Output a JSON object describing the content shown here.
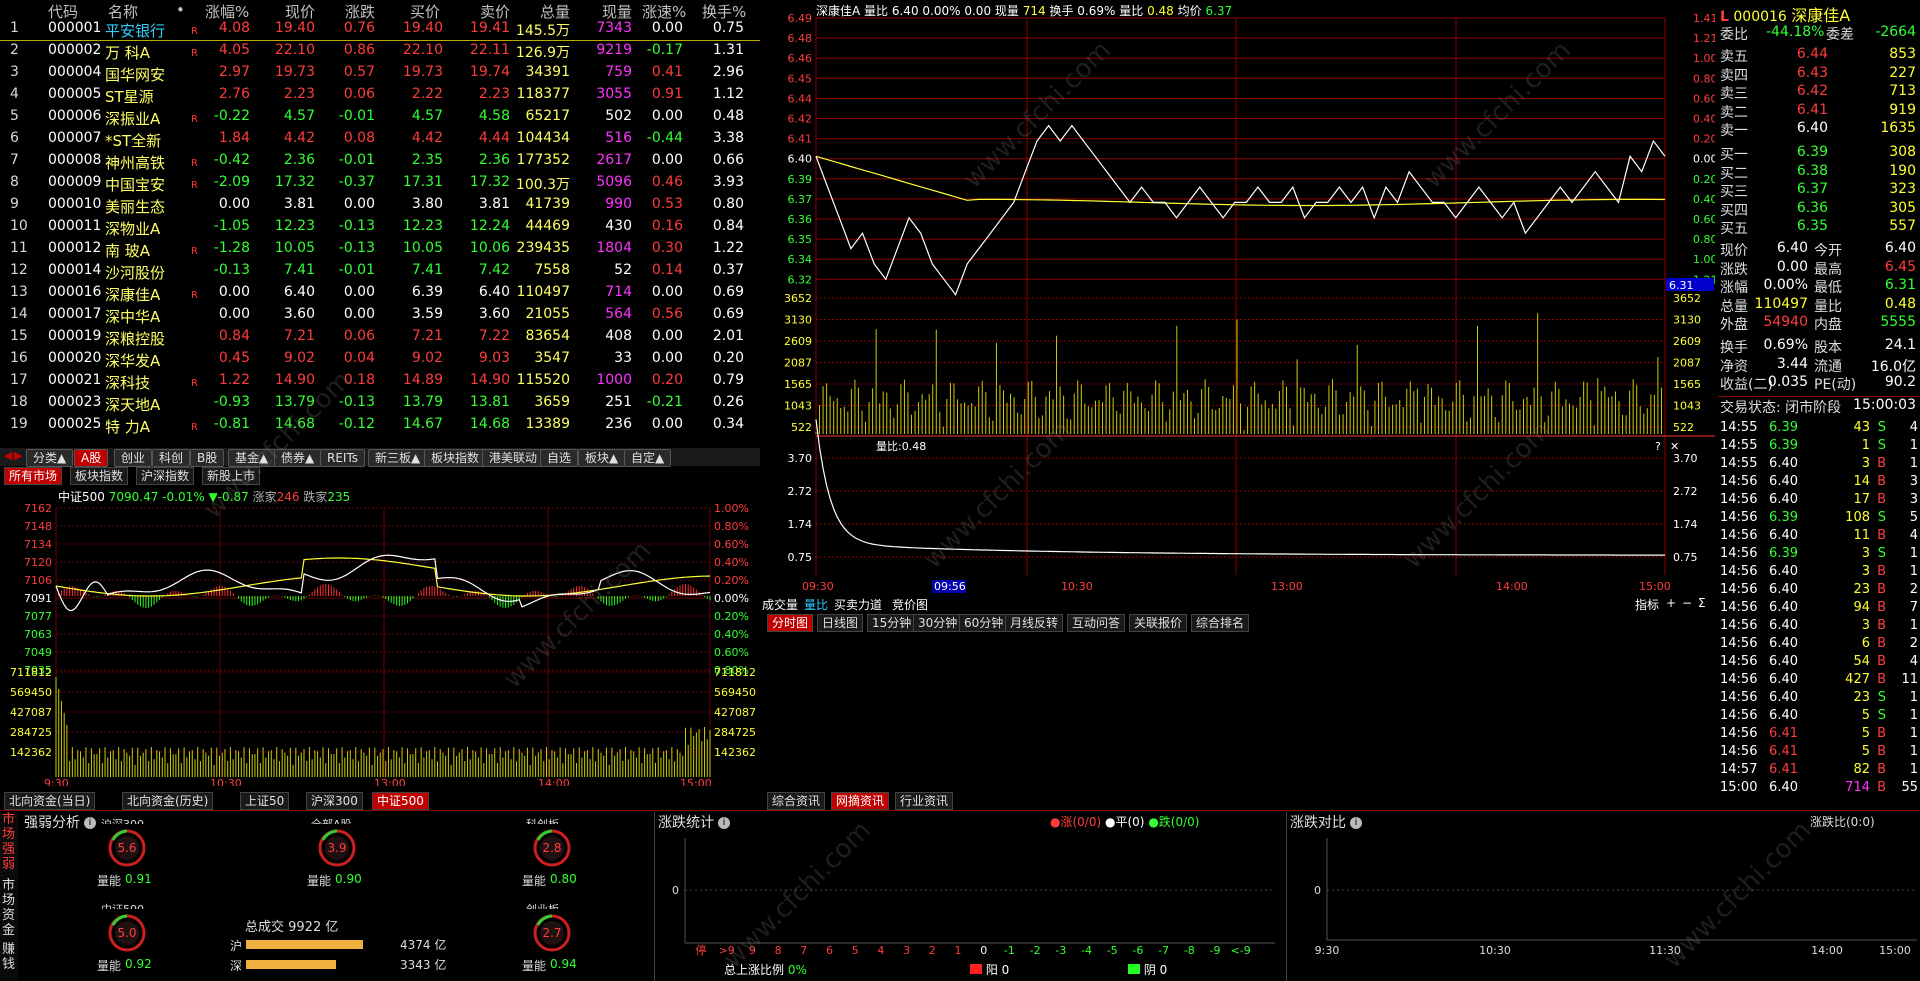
{
  "table": {
    "headers": [
      "代码",
      "名称",
      "•",
      "涨幅%",
      "现价",
      "涨跌",
      "买价",
      "卖价",
      "总量",
      "现量",
      "涨速%",
      "换手%"
    ],
    "rows": [
      {
        "n": "1",
        "code": "000001",
        "name": "平安银行",
        "r": "R",
        "chg": "4.08",
        "price": "19.40",
        "diff": "0.76",
        "bid": "19.40",
        "ask": "19.41",
        "vol": "145.5万",
        "cur": "7343",
        "spd": "0.00",
        "turn": "0.75",
        "dir": "up",
        "selected": true
      },
      {
        "n": "2",
        "code": "000002",
        "name": "万 科A",
        "r": "R",
        "chg": "4.05",
        "price": "22.10",
        "diff": "0.86",
        "bid": "22.10",
        "ask": "22.11",
        "vol": "126.9万",
        "cur": "9219",
        "spd": "-0.17",
        "turn": "1.31",
        "dir": "up"
      },
      {
        "n": "3",
        "code": "000004",
        "name": "国华网安",
        "r": "",
        "chg": "2.97",
        "price": "19.73",
        "diff": "0.57",
        "bid": "19.73",
        "ask": "19.74",
        "vol": "34391",
        "cur": "759",
        "spd": "0.41",
        "turn": "2.96",
        "dir": "up"
      },
      {
        "n": "4",
        "code": "000005",
        "name": "ST星源",
        "r": "",
        "chg": "2.76",
        "price": "2.23",
        "diff": "0.06",
        "bid": "2.22",
        "ask": "2.23",
        "vol": "118377",
        "cur": "3055",
        "spd": "0.91",
        "turn": "1.12",
        "dir": "up"
      },
      {
        "n": "5",
        "code": "000006",
        "name": "深振业A",
        "r": "R",
        "chg": "-0.22",
        "price": "4.57",
        "diff": "-0.01",
        "bid": "4.57",
        "ask": "4.58",
        "vol": "65217",
        "cur": "502",
        "spd": "0.00",
        "turn": "0.48",
        "dir": "down"
      },
      {
        "n": "6",
        "code": "000007",
        "name": "*ST全新",
        "r": "",
        "chg": "1.84",
        "price": "4.42",
        "diff": "0.08",
        "bid": "4.42",
        "ask": "4.44",
        "vol": "104434",
        "cur": "516",
        "spd": "-0.44",
        "turn": "3.38",
        "dir": "up"
      },
      {
        "n": "7",
        "code": "000008",
        "name": "神州高铁",
        "r": "R",
        "chg": "-0.42",
        "price": "2.36",
        "diff": "-0.01",
        "bid": "2.35",
        "ask": "2.36",
        "vol": "177352",
        "cur": "2617",
        "spd": "0.00",
        "turn": "0.66",
        "dir": "down"
      },
      {
        "n": "8",
        "code": "000009",
        "name": "中国宝安",
        "r": "R",
        "chg": "-2.09",
        "price": "17.32",
        "diff": "-0.37",
        "bid": "17.31",
        "ask": "17.32",
        "vol": "100.3万",
        "cur": "5096",
        "spd": "0.46",
        "turn": "3.93",
        "dir": "down"
      },
      {
        "n": "9",
        "code": "000010",
        "name": "美丽生态",
        "r": "",
        "chg": "0.00",
        "price": "3.81",
        "diff": "0.00",
        "bid": "3.80",
        "ask": "3.81",
        "vol": "41739",
        "cur": "990",
        "spd": "0.53",
        "turn": "0.80",
        "dir": "flat"
      },
      {
        "n": "10",
        "code": "000011",
        "name": "深物业A",
        "r": "",
        "chg": "-1.05",
        "price": "12.23",
        "diff": "-0.13",
        "bid": "12.23",
        "ask": "12.24",
        "vol": "44469",
        "cur": "430",
        "spd": "0.16",
        "turn": "0.84",
        "dir": "down"
      },
      {
        "n": "11",
        "code": "000012",
        "name": "南 玻A",
        "r": "R",
        "chg": "-1.28",
        "price": "10.05",
        "diff": "-0.13",
        "bid": "10.05",
        "ask": "10.06",
        "vol": "239435",
        "cur": "1804",
        "spd": "0.30",
        "turn": "1.22",
        "dir": "down"
      },
      {
        "n": "12",
        "code": "000014",
        "name": "沙河股份",
        "r": "",
        "chg": "-0.13",
        "price": "7.41",
        "diff": "-0.01",
        "bid": "7.41",
        "ask": "7.42",
        "vol": "7558",
        "cur": "52",
        "spd": "0.14",
        "turn": "0.37",
        "dir": "down"
      },
      {
        "n": "13",
        "code": "000016",
        "name": "深康佳A",
        "r": "R",
        "chg": "0.00",
        "price": "6.40",
        "diff": "0.00",
        "bid": "6.39",
        "ask": "6.40",
        "vol": "110497",
        "cur": "714",
        "spd": "0.00",
        "turn": "0.69",
        "dir": "flat"
      },
      {
        "n": "14",
        "code": "000017",
        "name": "深中华A",
        "r": "",
        "chg": "0.00",
        "price": "3.60",
        "diff": "0.00",
        "bid": "3.59",
        "ask": "3.60",
        "vol": "21055",
        "cur": "564",
        "spd": "0.56",
        "turn": "0.69",
        "dir": "flat"
      },
      {
        "n": "15",
        "code": "000019",
        "name": "深粮控股",
        "r": "",
        "chg": "0.84",
        "price": "7.21",
        "diff": "0.06",
        "bid": "7.21",
        "ask": "7.22",
        "vol": "83654",
        "cur": "408",
        "spd": "0.00",
        "turn": "2.01",
        "dir": "up"
      },
      {
        "n": "16",
        "code": "000020",
        "name": "深华发A",
        "r": "",
        "chg": "0.45",
        "price": "9.02",
        "diff": "0.04",
        "bid": "9.02",
        "ask": "9.03",
        "vol": "3547",
        "cur": "33",
        "spd": "0.00",
        "turn": "0.20",
        "dir": "up"
      },
      {
        "n": "17",
        "code": "000021",
        "name": "深科技",
        "r": "R",
        "chg": "1.22",
        "price": "14.90",
        "diff": "0.18",
        "bid": "14.89",
        "ask": "14.90",
        "vol": "115520",
        "cur": "1000",
        "spd": "0.20",
        "turn": "0.79",
        "dir": "up"
      },
      {
        "n": "18",
        "code": "000023",
        "name": "深天地A",
        "r": "",
        "chg": "-0.93",
        "price": "13.79",
        "diff": "-0.13",
        "bid": "13.79",
        "ask": "13.81",
        "vol": "3659",
        "cur": "251",
        "spd": "-0.21",
        "turn": "0.26",
        "dir": "down"
      },
      {
        "n": "19",
        "code": "000025",
        "name": "特 力A",
        "r": "R",
        "chg": "-0.81",
        "price": "14.68",
        "diff": "-0.12",
        "bid": "14.67",
        "ask": "14.68",
        "vol": "13389",
        "cur": "236",
        "spd": "0.00",
        "turn": "0.34",
        "dir": "down"
      }
    ]
  },
  "category_tabs": [
    "分类▲",
    "A股",
    "创业",
    "科创",
    "B股",
    "基金▲",
    "债券▲",
    "REITs",
    "新三板▲",
    "板块指数",
    "港美联动",
    "自选",
    "板块▲",
    "自定▲"
  ],
  "market_tabs": [
    "所有市场",
    "板块指数",
    "沪深指数",
    "新股上市"
  ],
  "index_chart": {
    "name": "中证500",
    "value": "7090.47",
    "pct": "-0.01%",
    "change": "▼-0.87",
    "up_label": "涨家",
    "up_count": "246",
    "down_label": "跌家",
    "down_count": "235",
    "yticks": [
      "7162",
      "7148",
      "7134",
      "7120",
      "7106",
      "7091",
      "7077",
      "7063",
      "7049",
      "7035"
    ],
    "pcticks": [
      "1.00%",
      "0.80%",
      "0.60%",
      "0.40%",
      "0.20%",
      "0.00%",
      "0.20%",
      "0.40%",
      "0.60%",
      "0.80%"
    ],
    "volticks": [
      "711812",
      "569450",
      "427087",
      "284725",
      "142362"
    ],
    "xticks": [
      "9:30",
      "10:30",
      "13:00",
      "14:00",
      "15:00"
    ]
  },
  "index_tabs": [
    "北向资金(当日)",
    "北向资金(历史)",
    "上证50",
    "沪深300",
    "中证500"
  ],
  "stock_chart": {
    "name": "深康佳A",
    "info": "量比 6.40 0.00%",
    "info2": "0.00 现量",
    "cur_vol": "714",
    "turnover_lbl": "换手 0.69% 量比",
    "vol_ratio": "0.48",
    "avg_lbl": "均价",
    "avg": "6.37",
    "yticks": [
      "6.49",
      "6.48",
      "6.46",
      "6.45",
      "6.44",
      "6.42",
      "6.41",
      "6.40",
      "6.39",
      "6.37",
      "6.36",
      "6.35",
      "6.34",
      "6.32"
    ],
    "pcticks": [
      "1.41%",
      "1.21%",
      "1.00%",
      "0.80%",
      "0.60%",
      "0.40%",
      "0.20%",
      "0.00%",
      "0.20%",
      "0.40%",
      "0.60%",
      "0.80%",
      "1.00%",
      "1.21%"
    ],
    "cur_price_tag": "6.31",
    "volticks": [
      "3652",
      "3130",
      "2609",
      "2087",
      "1565",
      "1043",
      "522"
    ],
    "ratio_label": "量比:0.48",
    "ratio_ticks": [
      "3.70",
      "2.72",
      "1.74",
      "0.75"
    ],
    "xticks": [
      "09:30",
      "09:56",
      "10:30",
      "13:00",
      "14:00",
      "15:00"
    ]
  },
  "stock_tabs": [
    "成交量",
    "量比",
    "买卖力道",
    "竞价图"
  ],
  "period_tabs": [
    "分时图",
    "日线图",
    "15分钟",
    "30分钟",
    "60分钟",
    "月线反转",
    "互动问答",
    "关联报价",
    "综合排名"
  ],
  "indicator_label": "指标",
  "news_tabs": [
    "综合资讯",
    "网摘资讯",
    "行业资讯"
  ],
  "quote": {
    "code": "000016",
    "name": "深康佳A",
    "wb_label": "委比",
    "wb": "-44.18%",
    "wc_label": "委差",
    "wc": "-2664",
    "asks": [
      {
        "l": "卖五",
        "p": "6.44",
        "v": "853"
      },
      {
        "l": "卖四",
        "p": "6.43",
        "v": "227"
      },
      {
        "l": "卖三",
        "p": "6.42",
        "v": "713"
      },
      {
        "l": "卖二",
        "p": "6.41",
        "v": "919"
      },
      {
        "l": "卖一",
        "p": "6.40",
        "v": "1635"
      }
    ],
    "bids": [
      {
        "l": "买一",
        "p": "6.39",
        "v": "308"
      },
      {
        "l": "买二",
        "p": "6.38",
        "v": "190"
      },
      {
        "l": "买三",
        "p": "6.37",
        "v": "323"
      },
      {
        "l": "买四",
        "p": "6.36",
        "v": "305"
      },
      {
        "l": "买五",
        "p": "6.35",
        "v": "557"
      }
    ],
    "stats": [
      {
        "l1": "现价",
        "v1": "6.40",
        "l2": "今开",
        "v2": "6.40",
        "c1": "white",
        "c2": "white"
      },
      {
        "l1": "涨跌",
        "v1": "0.00",
        "l2": "最高",
        "v2": "6.45",
        "c1": "white",
        "c2": "red"
      },
      {
        "l1": "涨幅",
        "v1": "0.00%",
        "l2": "最低",
        "v2": "6.31",
        "c1": "white",
        "c2": "green"
      },
      {
        "l1": "总量",
        "v1": "110497",
        "l2": "量比",
        "v2": "0.48",
        "c1": "yellow",
        "c2": "yellow"
      },
      {
        "l1": "外盘",
        "v1": "54940",
        "l2": "内盘",
        "v2": "5555",
        "c1": "red",
        "c2": "green"
      }
    ],
    "stats2": [
      {
        "l1": "换手",
        "v1": "0.69%",
        "l2": "股本",
        "v2": "24.1"
      },
      {
        "l1": "净资",
        "v1": "3.44",
        "l2": "流通",
        "v2": "16.0亿"
      },
      {
        "l1": "收益(二)",
        "v1": "0.035",
        "l2": "PE(动)",
        "v2": "90.2"
      }
    ],
    "trade_status_label": "交易状态: 闭市阶段",
    "trade_time": "15:00:03"
  },
  "ticks": [
    {
      "t": "14:55",
      "p": "6.39",
      "v": "43",
      "d": "S",
      "n": "4",
      "pc": "green",
      "vc": "white"
    },
    {
      "t": "14:55",
      "p": "6.39",
      "v": "1",
      "d": "S",
      "n": "1",
      "pc": "green",
      "vc": "white"
    },
    {
      "t": "14:55",
      "p": "6.40",
      "v": "3",
      "d": "B",
      "n": "1",
      "pc": "white",
      "vc": "white"
    },
    {
      "t": "14:56",
      "p": "6.40",
      "v": "14",
      "d": "B",
      "n": "3",
      "pc": "white",
      "vc": "white"
    },
    {
      "t": "14:56",
      "p": "6.40",
      "v": "17",
      "d": "B",
      "n": "3",
      "pc": "white",
      "vc": "white"
    },
    {
      "t": "14:56",
      "p": "6.39",
      "v": "108",
      "d": "S",
      "n": "5",
      "pc": "green",
      "vc": "white"
    },
    {
      "t": "14:56",
      "p": "6.40",
      "v": "11",
      "d": "B",
      "n": "4",
      "pc": "white",
      "vc": "white"
    },
    {
      "t": "14:56",
      "p": "6.39",
      "v": "3",
      "d": "S",
      "n": "1",
      "pc": "green",
      "vc": "white"
    },
    {
      "t": "14:56",
      "p": "6.40",
      "v": "3",
      "d": "B",
      "n": "1",
      "pc": "white",
      "vc": "white"
    },
    {
      "t": "14:56",
      "p": "6.40",
      "v": "23",
      "d": "B",
      "n": "2",
      "pc": "white",
      "vc": "white"
    },
    {
      "t": "14:56",
      "p": "6.40",
      "v": "94",
      "d": "B",
      "n": "7",
      "pc": "white",
      "vc": "white"
    },
    {
      "t": "14:56",
      "p": "6.40",
      "v": "3",
      "d": "B",
      "n": "1",
      "pc": "white",
      "vc": "white"
    },
    {
      "t": "14:56",
      "p": "6.40",
      "v": "6",
      "d": "B",
      "n": "2",
      "pc": "white",
      "vc": "white"
    },
    {
      "t": "14:56",
      "p": "6.40",
      "v": "54",
      "d": "B",
      "n": "4",
      "pc": "white",
      "vc": "white"
    },
    {
      "t": "14:56",
      "p": "6.40",
      "v": "427",
      "d": "B",
      "n": "11",
      "pc": "white",
      "vc": "white"
    },
    {
      "t": "14:56",
      "p": "6.40",
      "v": "23",
      "d": "S",
      "n": "1",
      "pc": "white",
      "vc": "white"
    },
    {
      "t": "14:56",
      "p": "6.40",
      "v": "5",
      "d": "S",
      "n": "1",
      "pc": "white",
      "vc": "white"
    },
    {
      "t": "14:56",
      "p": "6.41",
      "v": "5",
      "d": "B",
      "n": "1",
      "pc": "red",
      "vc": "white"
    },
    {
      "t": "14:56",
      "p": "6.41",
      "v": "5",
      "d": "B",
      "n": "1",
      "pc": "red",
      "vc": "white"
    },
    {
      "t": "14:57",
      "p": "6.41",
      "v": "82",
      "d": "B",
      "n": "1",
      "pc": "red",
      "vc": "white"
    },
    {
      "t": "15:00",
      "p": "6.40",
      "v": "714",
      "d": "B",
      "n": "55",
      "pc": "white",
      "vc": "magenta"
    }
  ],
  "bottom": {
    "strength_title": "强弱分析",
    "side_labels": [
      "市场强弱",
      "市场资金",
      "赚钱"
    ],
    "gauges": [
      {
        "name": "沪深300",
        "score": "5.6",
        "vr_label": "量能",
        "vr": "0.91"
      },
      {
        "name": "全部A股",
        "score": "3.9",
        "vr_label": "量能",
        "vr": "0.90"
      },
      {
        "name": "科创板",
        "score": "2.8",
        "vr_label": "量能",
        "vr": "0.80"
      },
      {
        "name": "中证500",
        "score": "5.0",
        "vr_label": "量能",
        "vr": "0.92"
      },
      {
        "name": "创业板",
        "score": "2.7",
        "vr_label": "量能",
        "vr": "0.94"
      }
    ],
    "turnover_label": "总成交 9922 亿",
    "sh_label": "沪",
    "sh_value": "4374 亿",
    "sh_ratio": 0.65,
    "sz_label": "深",
    "sz_value": "3343 亿",
    "sz_ratio": 0.5,
    "updown_title": "涨跌统计",
    "legend_up": "涨(0/0)",
    "legend_flat": "平(0)",
    "legend_down": "跌(0/0)",
    "updown_xticks": [
      "停",
      ">9",
      "9",
      "8",
      "7",
      "6",
      "5",
      "4",
      "3",
      "2",
      "1",
      "0",
      "-1",
      "-2",
      "-3",
      "-4",
      "-5",
      "-6",
      "-7",
      "-8",
      "-9",
      "<-9"
    ],
    "updown_zero": "0",
    "ratio_label": "总上涨比例",
    "ratio_value": "0%",
    "yang_label": "阳 0",
    "yin_label": "阴 0",
    "compare_title": "涨跌对比",
    "compare_right_label": "涨跌比(0:0)",
    "compare_zero": "0",
    "compare_xticks": [
      "9:30",
      "10:30",
      "11:30",
      "14:00",
      "15:00"
    ]
  }
}
